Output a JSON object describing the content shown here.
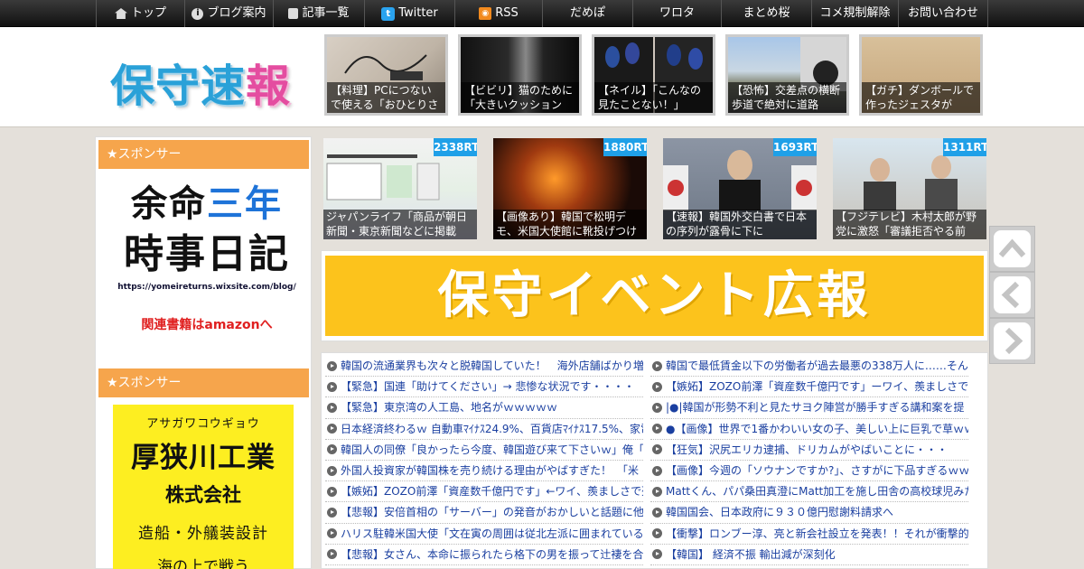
{
  "nav": {
    "items": [
      {
        "label": "トップ",
        "icon": "home-icon"
      },
      {
        "label": "ブログ案内",
        "icon": "info-icon"
      },
      {
        "label": "記事一覧",
        "icon": "list-icon"
      },
      {
        "label": "Twitter",
        "icon": "twitter-icon"
      },
      {
        "label": "RSS",
        "icon": "rss-icon"
      },
      {
        "label": "だめぽ"
      },
      {
        "label": "ワロタ"
      },
      {
        "label": "まとめ桜"
      },
      {
        "label": "コメ規制解除"
      },
      {
        "label": "お問い合わせ"
      }
    ]
  },
  "logo": {
    "c1": "保",
    "c2": "守",
    "c3": "速",
    "c4": "報"
  },
  "header_thumbs": [
    {
      "caption": "【料理】PCにつないで使える「おひとりさ"
    },
    {
      "caption": "【ビビリ】猫のために「大きいクッション"
    },
    {
      "caption": "【ネイル】「こんなの見たことない！」"
    },
    {
      "caption": "【恐怖】交差点の横断歩道で絶対に道路"
    },
    {
      "caption": "【ガチ】ダンボールで作ったジェスタが"
    }
  ],
  "sidebar": {
    "sponsor_label": "★スポンサー",
    "ad1": {
      "line1a": "余命",
      "line1b": "三年",
      "line2": "時事日記",
      "url": "https://yomeireturns.wixsite.com/blog/",
      "amazon": "関連書籍はamazonへ"
    },
    "ad2": {
      "kana": "アサガワコウギョウ",
      "name": "厚狭川工業",
      "corp": "株式会社",
      "business": "造船・外艤装設計",
      "more": "海の上で戦う"
    }
  },
  "rt_items": [
    {
      "count": "2338RT",
      "caption": "ジャパンライフ「商品が朝日新聞・東京新聞などに掲載"
    },
    {
      "count": "1880RT",
      "caption": "【画像あり】韓国で松明デモ、米国大使館に靴投げつけ"
    },
    {
      "count": "1693RT",
      "caption": "【速報】韓国外交白書で日本の序列が露骨に下に"
    },
    {
      "count": "1311RT",
      "caption": "【フジテレビ】木村太郎が野党に激怒「審議拒否やる前"
    }
  ],
  "banner": {
    "text": "保守イベント広報"
  },
  "news_left": [
    "韓国の流通業界も次々と脱韓国していた！　海外店舗ばかり増",
    "【緊急】国連「助けてください」→ 悲惨な状況です・・・・",
    "【緊急】東京湾の人工島、地名がｗｗｗｗｗ",
    "日本経済終わるｗ 自動車ﾏｲﾅｽ24.9%、百貨店ﾏｲﾅｽ17.5%、家電ﾏｲ",
    "韓国人の同僚「良かったら今度、韓国遊び来て下さいｗ」俺「行",
    "外国人投資家が韓国株を売り続ける理由がやばすぎた！　「米",
    "【嫉妬】ZOZO前澤「資産数千億円です」←ワイ、羨ましさで死",
    "【悲報】安倍首相の「サーバー」の発音がおかしいと話題に他",
    "ハリス駐韓米国大使「文在寅の周囲は従北左派に囲まれている",
    "【悲報】女さん、本命に振られたら格下の男を振って辻褄を合"
  ],
  "news_right": [
    "韓国で最低賃金以下の労働者が過去最悪の338万人に……そんな",
    "【嫉妬】ZOZO前澤「資産数千億円です」ーワイ、羨ましさで死",
    "|●|韓国が形勢不利と見たサヨク陣営が勝手すぎる講和案を提",
    "●【画像】世界で1番かわいい女の子、美しい上に巨乳で草ｗｗ",
    "【狂気】沢尻エリカ逮捕、ドリカムがやばいことに・・・",
    "【画像】今週の「ソウナンですか?」、さすがに下品すぎるｗｗ",
    "Mattくん、パパ桑田真澄にMatt加工を施し田舎の高校球児みたい",
    "韓国国会、日本政府に９３０億円慰謝料請求へ",
    "【衝撃】ロンブー淳、亮と新会社設立を発表！！それが衝撃的",
    "【韓国】 経済不振 輸出減が深刻化"
  ],
  "colors": {
    "sponsor_header": "#f6a54c",
    "rt_badge": "#1fa0e8",
    "banner_bg": "#fcc31c",
    "ad2_bg": "#fdee21",
    "link": "#1a3fa0"
  }
}
